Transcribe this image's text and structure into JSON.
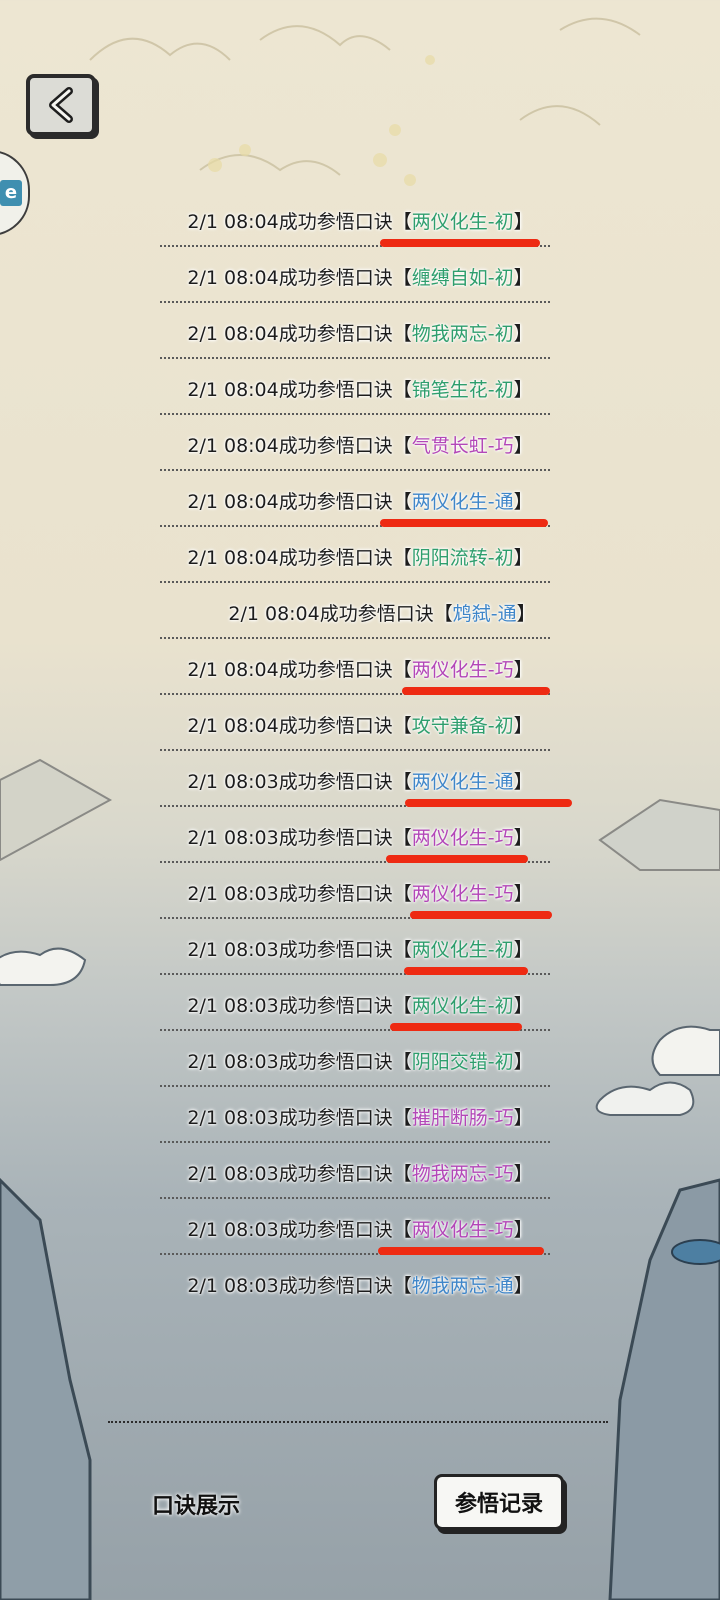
{
  "colors": {
    "chu": "#2e9e6d",
    "tong": "#3f86c9",
    "qiao": "#b347b8",
    "highlight": "#ee2a12"
  },
  "icons": {
    "back": "chevron-left-icon",
    "side_tab": "side-tab-icon"
  },
  "side_tab": {
    "label": "e"
  },
  "log": {
    "prefix": "成功参悟口诀",
    "open_bracket": "【",
    "close_bracket": "】",
    "entries": [
      {
        "time": "2/1 08:04",
        "mantra": "两仪化生-初",
        "tier": "chu",
        "highlighted": true
      },
      {
        "time": "2/1 08:04",
        "mantra": "缠缚自如-初",
        "tier": "chu",
        "highlighted": false
      },
      {
        "time": "2/1 08:04",
        "mantra": "物我两忘-初",
        "tier": "chu",
        "highlighted": false
      },
      {
        "time": "2/1 08:04",
        "mantra": "锦笔生花-初",
        "tier": "chu",
        "highlighted": false
      },
      {
        "time": "2/1 08:04",
        "mantra": "气贯长虹-巧",
        "tier": "qiao",
        "highlighted": false
      },
      {
        "time": "2/1 08:04",
        "mantra": "两仪化生-通",
        "tier": "tong",
        "highlighted": true
      },
      {
        "time": "2/1 08:04",
        "mantra": "阴阳流转-初",
        "tier": "chu",
        "highlighted": false
      },
      {
        "time": "2/1 08:04",
        "mantra": "鸩弑-通",
        "tier": "tong",
        "highlighted": false
      },
      {
        "time": "2/1 08:04",
        "mantra": "两仪化生-巧",
        "tier": "qiao",
        "highlighted": true
      },
      {
        "time": "2/1 08:04",
        "mantra": "攻守兼备-初",
        "tier": "chu",
        "highlighted": false
      },
      {
        "time": "2/1 08:03",
        "mantra": "两仪化生-通",
        "tier": "tong",
        "highlighted": true
      },
      {
        "time": "2/1 08:03",
        "mantra": "两仪化生-巧",
        "tier": "qiao",
        "highlighted": true
      },
      {
        "time": "2/1 08:03",
        "mantra": "两仪化生-巧",
        "tier": "qiao",
        "highlighted": true
      },
      {
        "time": "2/1 08:03",
        "mantra": "两仪化生-初",
        "tier": "chu",
        "highlighted": true
      },
      {
        "time": "2/1 08:03",
        "mantra": "两仪化生-初",
        "tier": "chu",
        "highlighted": true
      },
      {
        "time": "2/1 08:03",
        "mantra": "阴阳交错-初",
        "tier": "chu",
        "highlighted": false
      },
      {
        "time": "2/1 08:03",
        "mantra": "摧肝断肠-巧",
        "tier": "qiao",
        "highlighted": false
      },
      {
        "time": "2/1 08:03",
        "mantra": "物我两忘-巧",
        "tier": "qiao",
        "highlighted": false
      },
      {
        "time": "2/1 08:03",
        "mantra": "两仪化生-巧",
        "tier": "qiao",
        "highlighted": true
      },
      {
        "time": "2/1 08:03",
        "mantra": "物我两忘-通",
        "tier": "tong",
        "highlighted": false
      }
    ]
  },
  "tabs": {
    "showcase": "口诀展示",
    "records": "参悟记录"
  }
}
